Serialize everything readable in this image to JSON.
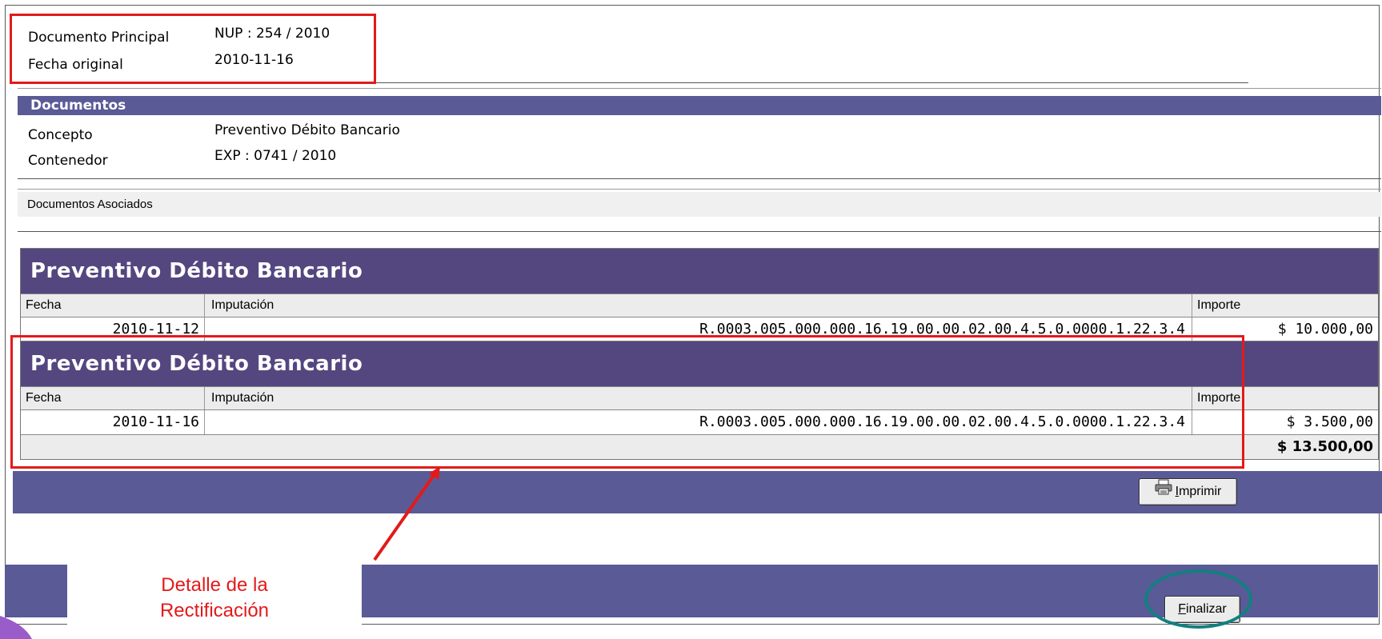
{
  "header": {
    "doc_principal_label": "Documento Principal",
    "doc_principal_value": "NUP : 254 / 2010",
    "fecha_original_label": "Fecha original",
    "fecha_original_value": "2010-11-16"
  },
  "documentos": {
    "title": "Documentos",
    "concepto_label": "Concepto",
    "concepto_value": "Preventivo Débito Bancario",
    "contenedor_label": "Contenedor",
    "contenedor_value": "EXP : 0741 / 2010"
  },
  "asociados": {
    "label": "Documentos Asociados"
  },
  "grids": [
    {
      "title": "Preventivo Débito Bancario",
      "headers": {
        "fecha": "Fecha",
        "imputacion": "Imputación",
        "importe": "Importe"
      },
      "rows": [
        {
          "fecha": "2010-11-12",
          "imputacion": "R.0003.005.000.000.16.19.00.00.02.00.4.5.0.0000.1.22.3.4",
          "importe": "$ 10.000,00"
        }
      ]
    },
    {
      "title": "Preventivo Débito Bancario",
      "headers": {
        "fecha": "Fecha",
        "imputacion": "Imputación",
        "importe": "Importe"
      },
      "rows": [
        {
          "fecha": "2010-11-16",
          "imputacion": "R.0003.005.000.000.16.19.00.00.02.00.4.5.0.0000.1.22.3.4",
          "importe": "$ 3.500,00"
        }
      ],
      "total": "$ 13.500,00"
    }
  ],
  "buttons": {
    "imprimir_first": "I",
    "imprimir_rest": "mprimir",
    "finalizar_first": "F",
    "finalizar_rest": "inalizar"
  },
  "annotation": {
    "callout_line1": "Detalle de la",
    "callout_line2": "Rectificación",
    "red_color": "#e31a1a",
    "teal_color": "#118080"
  },
  "colors": {
    "band": "#5a5a97",
    "grid_title": "#544780"
  }
}
